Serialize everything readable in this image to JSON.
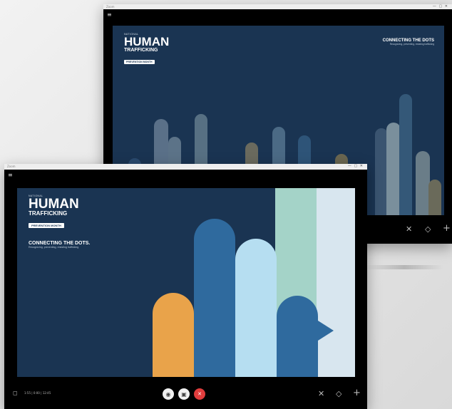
{
  "back_window": {
    "titlebar_text": "Zoom",
    "window_controls": "— ▢ ✕",
    "menu_icon": "≡",
    "slide": {
      "org_tag": "NATIONAL",
      "headline": "HUMAN",
      "subheadline": "TRAFFICKING",
      "pill": "PREVENTION MONTH",
      "tagline_title": "CONNECTING THE DOTS",
      "tagline_sub": "Recognizing, preventing, resisting trafficking"
    },
    "controls": {
      "close": "✕",
      "shield": "◇",
      "add": "+"
    }
  },
  "front_window": {
    "titlebar_text": "Zoom",
    "window_controls": "— ▢ ✕",
    "menu_icon": "≡",
    "slide": {
      "org_tag": "NATIONAL",
      "headline": "HUMAN",
      "subheadline": "TRAFFICKING",
      "pill": "PREVENTION MONTH",
      "tagline_title": "CONNECTING THE DOTS.",
      "tagline_sub": "Recognizing, preventing, resisting trafficking"
    },
    "participant_label": "1:55 | 0:00 | 12:45",
    "call_buttons": {
      "mic": "◉",
      "video": "▣",
      "end": "✕"
    },
    "controls": {
      "close": "✕",
      "shield": "◇",
      "add": "+"
    }
  },
  "colors": {
    "slide_bg": "#1a3452",
    "pillar_orange": "#e9a34a",
    "pillar_blue": "#2f6a9e",
    "pillar_lightblue": "#b6def1",
    "pillar_mint": "#a4d3c8",
    "pillar_pale": "#d8e6ef",
    "end_call_red": "#e13d3d"
  }
}
